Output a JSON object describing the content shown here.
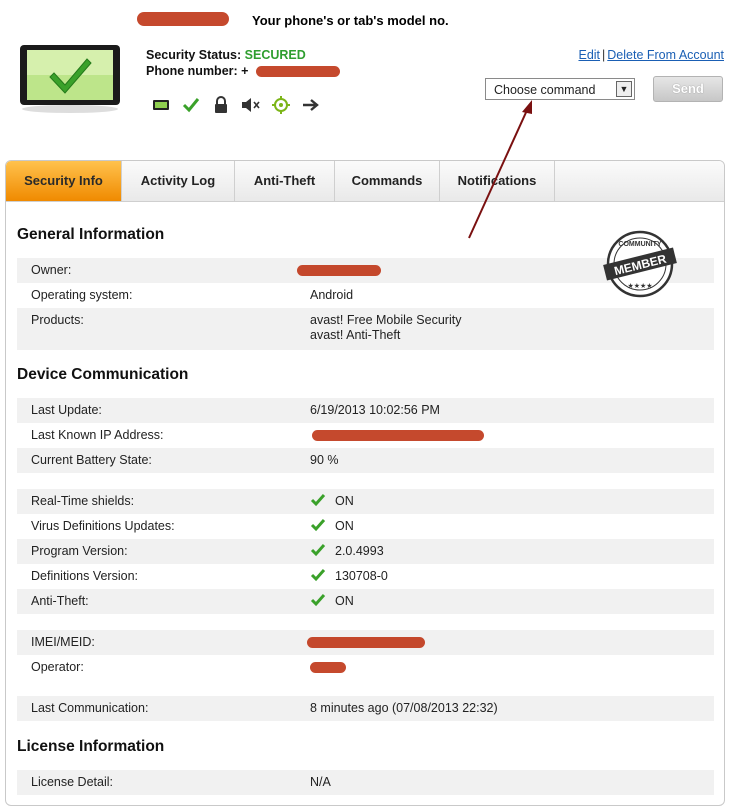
{
  "annotation": {
    "model_text": "Your phone's or tab's model no."
  },
  "device": {
    "status_label": "Security Status:",
    "status_value": "SECURED",
    "phone_label": "Phone number:",
    "phone_value": "+"
  },
  "toolbar_icons": [
    "device-icon",
    "check-icon",
    "lock-icon",
    "mute-icon",
    "locate-icon",
    "forward-arrow-icon"
  ],
  "links": {
    "edit": "Edit",
    "separator": "|",
    "delete": "Delete From Account"
  },
  "command": {
    "select_value": "Choose command",
    "send_label": "Send"
  },
  "tabs": [
    {
      "label": "Security Info",
      "active": true
    },
    {
      "label": "Activity Log",
      "active": false
    },
    {
      "label": "Anti-Theft",
      "active": false
    },
    {
      "label": "Commands",
      "active": false
    },
    {
      "label": "Notifications",
      "active": false
    }
  ],
  "badge": {
    "top": "COMMUNITY",
    "main": "MEMBER"
  },
  "sections": {
    "general": {
      "title": "General Information",
      "owner_label": "Owner:",
      "os_label": "Operating system:",
      "os_value": "Android",
      "products_label": "Products:",
      "products_value_1": "avast! Free Mobile Security",
      "products_value_2": "avast! Anti-Theft"
    },
    "device_comm": {
      "title": "Device Communication",
      "last_update_label": "Last Update:",
      "last_update_value": "6/19/2013 10:02:56 PM",
      "ip_label": "Last Known IP Address:",
      "battery_label": "Current Battery State:",
      "battery_value": "90 %",
      "shields_label": "Real-Time shields:",
      "shields_value": "ON",
      "vdu_label": "Virus Definitions Updates:",
      "vdu_value": "ON",
      "program_label": "Program Version:",
      "program_value": "2.0.4993",
      "defs_label": "Definitions Version:",
      "defs_value": "130708-0",
      "antitheft_label": "Anti-Theft:",
      "antitheft_value": "ON",
      "imei_label": "IMEI/MEID:",
      "operator_label": "Operator:",
      "lastcomm_label": "Last Communication:",
      "lastcomm_value": "8 minutes ago (07/08/2013 22:32)"
    },
    "license": {
      "title": "License Information",
      "detail_label": "License Detail:",
      "detail_value": "N/A"
    }
  },
  "colors": {
    "secured": "#2f9e2f",
    "tab_active": "#f08a00",
    "link": "#1a5fb4",
    "redaction": "#c0391b",
    "arrow": "#7a1010"
  }
}
